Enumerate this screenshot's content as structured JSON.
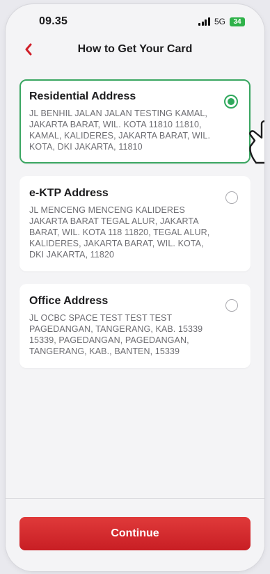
{
  "status_bar": {
    "time": "09.35",
    "network": "5G",
    "battery": "34"
  },
  "header": {
    "title": "How to Get Your Card"
  },
  "addresses": [
    {
      "title": "Residential Address",
      "address": "JL BENHIL JALAN JALAN TESTING KAMAL, JAKARTA BARAT, WIL. KOTA 11810 11810, KAMAL, KALIDERES, JAKARTA BARAT, WIL. KOTA, DKI JAKARTA, 11810",
      "selected": true
    },
    {
      "title": "e-KTP Address",
      "address": "JL MENCENG MENCENG KALIDERES JAKARTA BARAT TEGAL ALUR, JAKARTA BARAT, WIL. KOTA 118 11820, TEGAL ALUR, KALIDERES, JAKARTA BARAT, WIL. KOTA, DKI JAKARTA, 11820",
      "selected": false
    },
    {
      "title": "Office Address",
      "address": "JL OCBC SPACE TEST TEST TEST PAGEDANGAN, TANGERANG, KAB. 15339 15339, PAGEDANGAN, PAGEDANGAN, TANGERANG, KAB., BANTEN, 15339",
      "selected": false
    }
  ],
  "footer": {
    "continue_label": "Continue"
  },
  "colors": {
    "accent": "#2fa85c",
    "primary_button": "#d42a2e",
    "back_chevron": "#d0202a"
  },
  "icons": {
    "back": "chevron-left-icon",
    "selected_radio": "radio-checked-icon",
    "unselected_radio": "radio-unchecked-icon",
    "pointer": "hand-pointer-icon"
  }
}
